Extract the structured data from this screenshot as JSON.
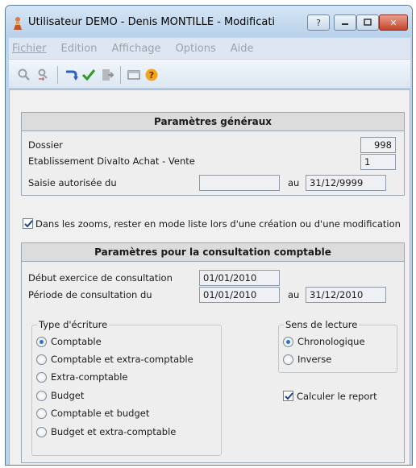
{
  "window": {
    "title": "Utilisateur DEMO - Denis MONTILLE - Modificati",
    "help_label": "?",
    "close_label": "✕"
  },
  "menu": {
    "fichier": "Fichier",
    "edition": "Edition",
    "affichage": "Affichage",
    "options": "Options",
    "aide": "Aide"
  },
  "toolbar": {
    "icons": [
      "search-icon",
      "search-replace-icon",
      "undo-arrow-icon",
      "validate-check-icon",
      "exit-door-icon",
      "window-icon",
      "help-icon"
    ]
  },
  "general": {
    "header": "Paramètres généraux",
    "dossier_label": "Dossier",
    "dossier_value": "998",
    "etablissement_label": "Etablissement Divalto Achat - Vente",
    "etablissement_value": "1",
    "saisie_label": "Saisie autorisée du",
    "saisie_from": "",
    "au_label": "au",
    "saisie_to": "31/12/9999"
  },
  "zoom_option": {
    "label": "Dans les zooms, rester en mode liste lors d'une création ou d'une modification",
    "checked": true
  },
  "consultation": {
    "header": "Paramètres pour la consultation comptable",
    "debut_label": "Début exercice de consultation",
    "debut_value": "01/01/2010",
    "periode_label": "Période de consultation du",
    "periode_from": "01/01/2010",
    "au_label": "au",
    "periode_to": "31/12/2010",
    "type_title": "Type d'écriture",
    "type_options": [
      "Comptable",
      "Comptable et extra-comptable",
      "Extra-comptable",
      "Budget",
      "Comptable et budget",
      "Budget et extra-comptable"
    ],
    "type_selected": "Comptable",
    "sens_title": "Sens de lecture",
    "sens_options": [
      "Chronologique",
      "Inverse"
    ],
    "sens_selected": "Chronologique",
    "report_label": "Calculer le report",
    "report_checked": true
  },
  "colors": {
    "frame": "#bcd4ec",
    "client": "#f0f0f0",
    "radio_selected": "#2a6fd6",
    "close_button": "#c5432a"
  }
}
